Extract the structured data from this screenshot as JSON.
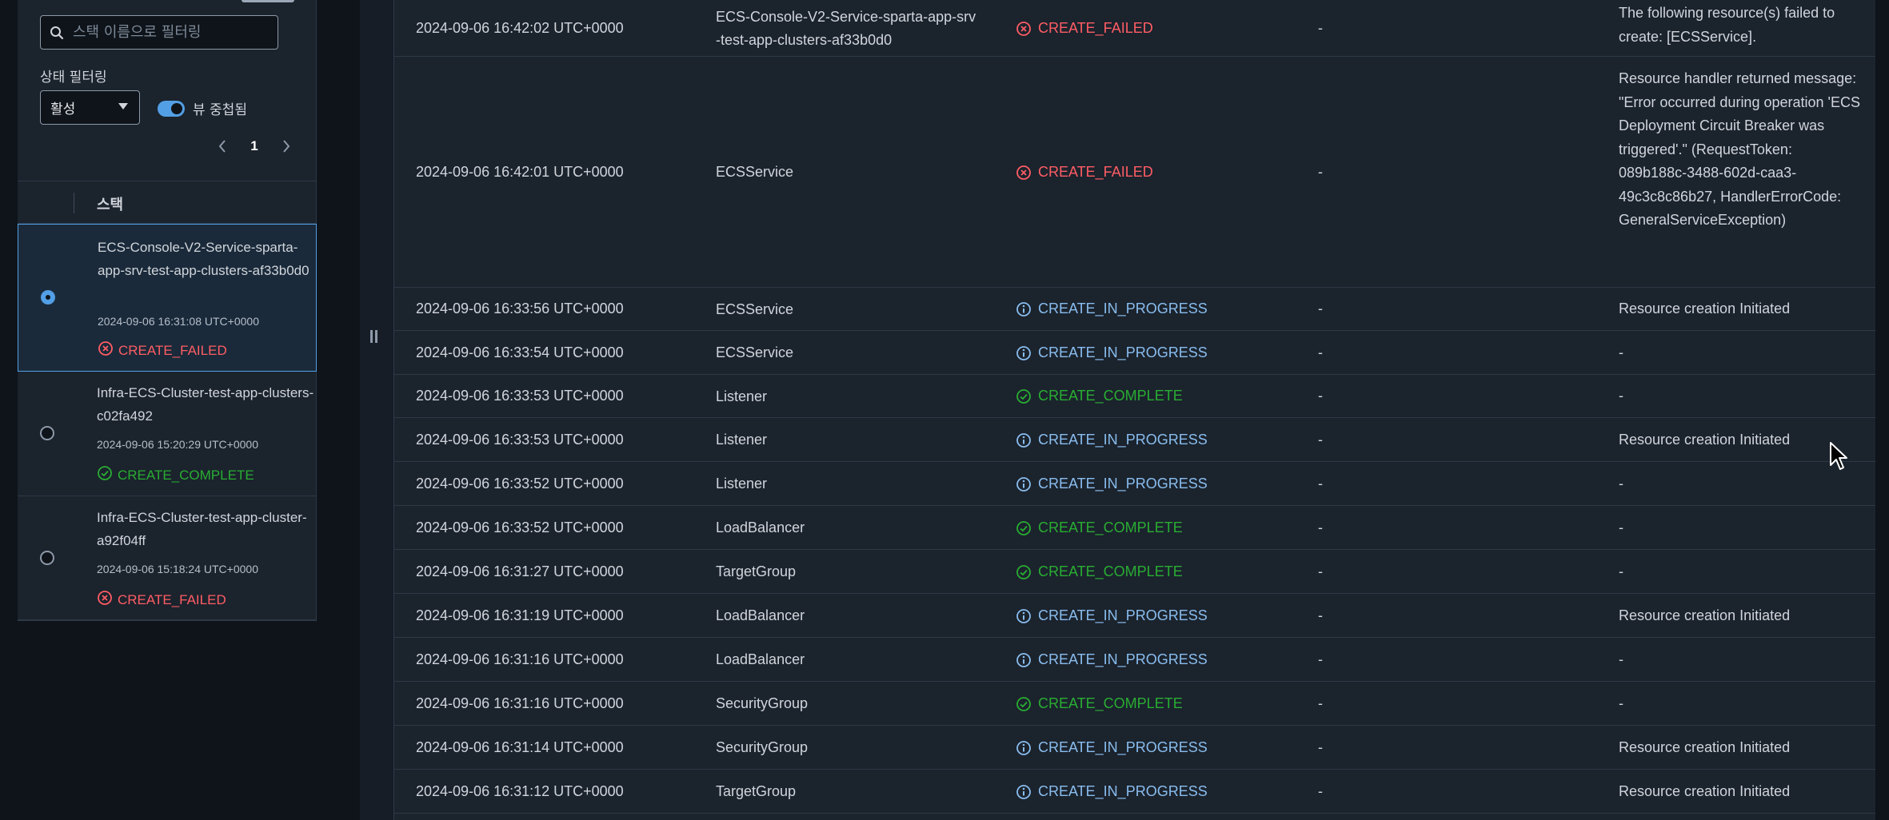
{
  "sidebar": {
    "search": {
      "placeholder": "스택 이름으로 필터링"
    },
    "status_filter": {
      "label": "상태 필터링",
      "selected": "활성"
    },
    "nested_toggle": {
      "label": "뷰 중첩됨",
      "on": true
    },
    "pagination": {
      "current_page": "1"
    },
    "list_header": "스택",
    "stacks": [
      {
        "name": "ECS-Console-V2-Service-sparta-app-srv-test-app-clusters-af33b0d0",
        "date": "2024-09-06 16:31:08 UTC+0000",
        "status": "CREATE_FAILED",
        "selected": true
      },
      {
        "name": "Infra-ECS-Cluster-test-app-clusters-c02fa492",
        "date": "2024-09-06 15:20:29 UTC+0000",
        "status": "CREATE_COMPLETE",
        "selected": false
      },
      {
        "name": "Infra-ECS-Cluster-test-app-cluster-a92f04ff",
        "date": "2024-09-06 15:18:24 UTC+0000",
        "status": "CREATE_FAILED",
        "selected": false
      }
    ]
  },
  "events": {
    "rows": [
      {
        "timestamp": "2024-09-06 16:42:02 UTC+0000",
        "logical_id": "ECS-Console-V2-Service-sparta-app-srv-test-app-clusters-af33b0d0",
        "status": "CREATE_FAILED",
        "type": "-",
        "reason": "The following resource(s) failed to create: [ECSService]."
      },
      {
        "timestamp": "2024-09-06 16:42:01 UTC+0000",
        "logical_id": "ECSService",
        "status": "CREATE_FAILED",
        "type": "-",
        "reason": "Resource handler returned message: \"Error occurred during operation 'ECS Deployment Circuit Breaker was triggered'.\" (RequestToken: 089b188c-3488-602d-caa3-49c3c8c86b27, HandlerErrorCode: GeneralServiceException)"
      },
      {
        "timestamp": "2024-09-06 16:33:56 UTC+0000",
        "logical_id": "ECSService",
        "status": "CREATE_IN_PROGRESS",
        "type": "-",
        "reason": "Resource creation Initiated"
      },
      {
        "timestamp": "2024-09-06 16:33:54 UTC+0000",
        "logical_id": "ECSService",
        "status": "CREATE_IN_PROGRESS",
        "type": "-",
        "reason": "-"
      },
      {
        "timestamp": "2024-09-06 16:33:53 UTC+0000",
        "logical_id": "Listener",
        "status": "CREATE_COMPLETE",
        "type": "-",
        "reason": "-"
      },
      {
        "timestamp": "2024-09-06 16:33:53 UTC+0000",
        "logical_id": "Listener",
        "status": "CREATE_IN_PROGRESS",
        "type": "-",
        "reason": "Resource creation Initiated"
      },
      {
        "timestamp": "2024-09-06 16:33:52 UTC+0000",
        "logical_id": "Listener",
        "status": "CREATE_IN_PROGRESS",
        "type": "-",
        "reason": "-"
      },
      {
        "timestamp": "2024-09-06 16:33:52 UTC+0000",
        "logical_id": "LoadBalancer",
        "status": "CREATE_COMPLETE",
        "type": "-",
        "reason": "-"
      },
      {
        "timestamp": "2024-09-06 16:31:27 UTC+0000",
        "logical_id": "TargetGroup",
        "status": "CREATE_COMPLETE",
        "type": "-",
        "reason": "-"
      },
      {
        "timestamp": "2024-09-06 16:31:19 UTC+0000",
        "logical_id": "LoadBalancer",
        "status": "CREATE_IN_PROGRESS",
        "type": "-",
        "reason": "Resource creation Initiated"
      },
      {
        "timestamp": "2024-09-06 16:31:16 UTC+0000",
        "logical_id": "LoadBalancer",
        "status": "CREATE_IN_PROGRESS",
        "type": "-",
        "reason": "-"
      },
      {
        "timestamp": "2024-09-06 16:31:16 UTC+0000",
        "logical_id": "SecurityGroup",
        "status": "CREATE_COMPLETE",
        "type": "-",
        "reason": "-"
      },
      {
        "timestamp": "2024-09-06 16:31:14 UTC+0000",
        "logical_id": "SecurityGroup",
        "status": "CREATE_IN_PROGRESS",
        "type": "-",
        "reason": "Resource creation Initiated"
      },
      {
        "timestamp": "2024-09-06 16:31:12 UTC+0000",
        "logical_id": "TargetGroup",
        "status": "CREATE_IN_PROGRESS",
        "type": "-",
        "reason": "Resource creation Initiated"
      }
    ]
  },
  "colors": {
    "failed": "#ff5d64",
    "in_progress": "#89bdee",
    "complete": "#29ad32",
    "accent": "#539fe5"
  },
  "icons": {
    "failed": "x-circle-icon",
    "in_progress": "info-circle-icon",
    "complete": "check-circle-icon"
  }
}
